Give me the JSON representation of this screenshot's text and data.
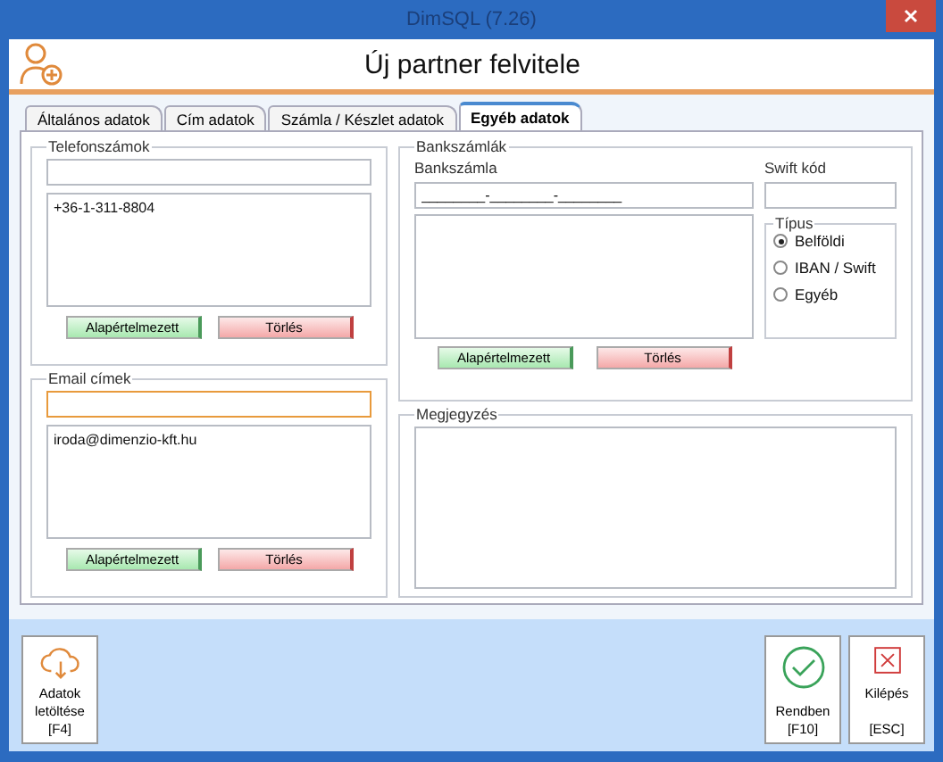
{
  "window": {
    "title": "DimSQL (7.26)"
  },
  "header": {
    "title": "Új partner felvitele"
  },
  "tabs": [
    {
      "label": "Általános adatok",
      "selected": false
    },
    {
      "label": "Cím adatok",
      "selected": false
    },
    {
      "label": "Számla / Készlet adatok",
      "selected": false
    },
    {
      "label": "Egyéb adatok",
      "selected": true
    }
  ],
  "phones": {
    "title": "Telefonszámok",
    "input": {
      "focused": false
    },
    "items": [
      "+36-1-311-8804"
    ],
    "buttons": [
      {
        "label": "Alapértelmezett",
        "kind": "default"
      },
      {
        "label": "Törlés",
        "kind": "delete"
      }
    ]
  },
  "emails": {
    "title": "Email címek",
    "input": {
      "focused": true
    },
    "items": [
      "iroda@dimenzio-kft.hu"
    ],
    "buttons": [
      {
        "label": "Alapértelmezett",
        "kind": "default"
      },
      {
        "label": "Törlés",
        "kind": "delete"
      }
    ]
  },
  "bank": {
    "title": "Bankszámlák",
    "account_label": "Bankszámla",
    "account_value": "________-________-________",
    "swift_label": "Swift kód",
    "type": {
      "title": "Típus",
      "options": [
        {
          "label": "Belföldi",
          "selected": true
        },
        {
          "label": "IBAN / Swift",
          "selected": false
        },
        {
          "label": "Egyéb",
          "selected": false
        }
      ]
    },
    "buttons": [
      {
        "label": "Alapértelmezett",
        "kind": "default"
      },
      {
        "label": "Törlés",
        "kind": "delete"
      }
    ]
  },
  "notes": {
    "title": "Megjegyzés"
  },
  "footer_left": [
    {
      "lines": [
        "Adatok",
        "letöltése",
        "[F4]"
      ]
    }
  ],
  "footer_right": [
    {
      "lines": [
        "Rendben",
        "[F10]"
      ]
    },
    {
      "lines": [
        "Kilépés",
        "[ESC]"
      ]
    }
  ]
}
